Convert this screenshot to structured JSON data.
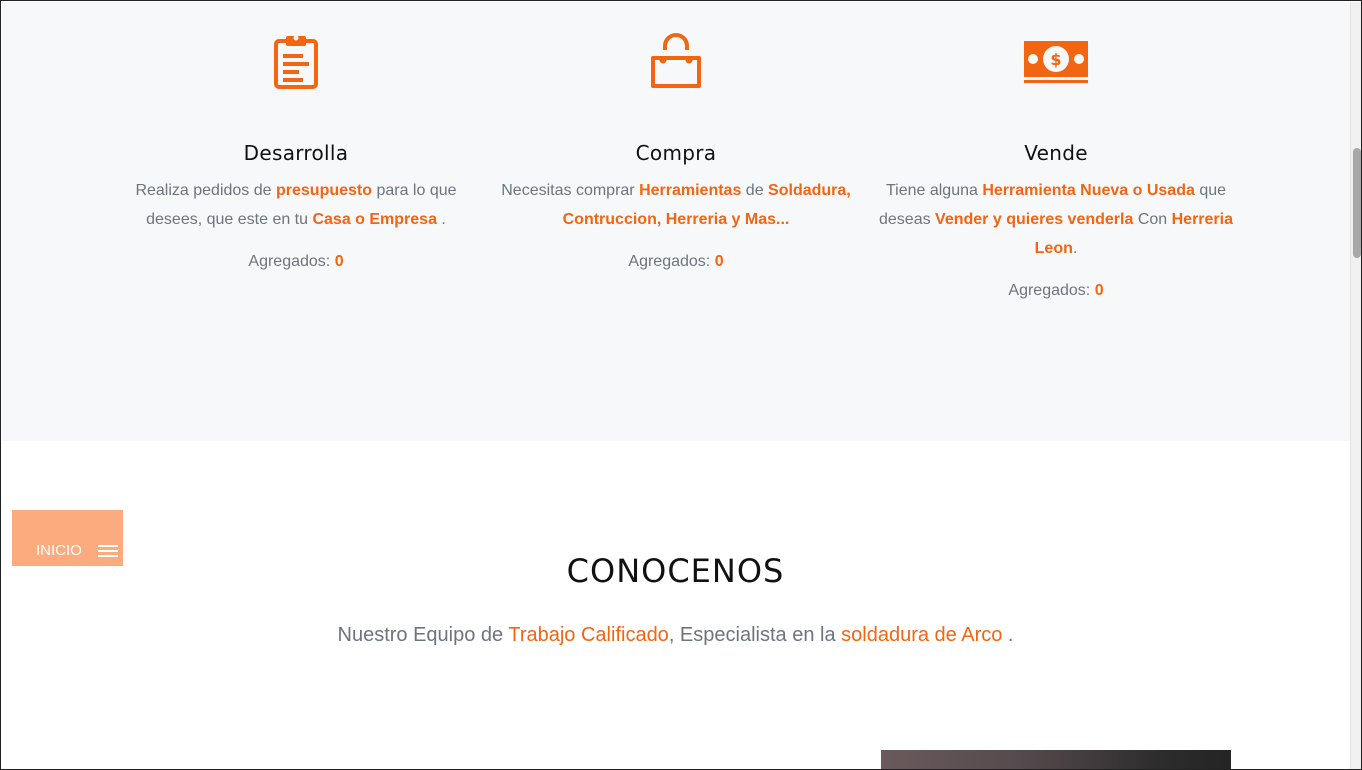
{
  "services": [
    {
      "icon": "clipboard-icon",
      "title": "Desarrolla",
      "desc": [
        {
          "t": "Realiza pedidos de ",
          "h": false
        },
        {
          "t": "presupuesto",
          "h": true
        },
        {
          "t": " para lo que desees, que este en tu ",
          "h": false
        },
        {
          "t": "Casa o Empresa",
          "h": true
        },
        {
          "t": " .",
          "h": false
        }
      ],
      "count_label": "Agregados:",
      "count_value": "0"
    },
    {
      "icon": "shopping-bag-icon",
      "title": "Compra",
      "desc": [
        {
          "t": "Necesitas comprar ",
          "h": false
        },
        {
          "t": "Herramientas",
          "h": true
        },
        {
          "t": " de ",
          "h": false
        },
        {
          "t": "Soldadura, Contruccion, Herreria y Mas...",
          "h": true
        }
      ],
      "count_label": "Agregados:",
      "count_value": "0"
    },
    {
      "icon": "money-bill-icon",
      "title": "Vende",
      "desc": [
        {
          "t": "Tiene alguna ",
          "h": false
        },
        {
          "t": "Herramienta Nueva o Usada",
          "h": true
        },
        {
          "t": " que deseas ",
          "h": false
        },
        {
          "t": "Vender y quieres venderla",
          "h": true
        },
        {
          "t": " Con ",
          "h": false
        },
        {
          "t": "Herreria Leon",
          "h": true
        },
        {
          "t": ".",
          "h": false
        }
      ],
      "count_label": "Agregados:",
      "count_value": "0"
    }
  ],
  "nav": {
    "inicio_label": "INICIO",
    "menu_icon": "hamburger-menu-icon"
  },
  "about": {
    "title": "CONOCENOS",
    "text": [
      {
        "t": "Nuestro Equipo de ",
        "h": false
      },
      {
        "t": "Trabajo Calificado",
        "h": true
      },
      {
        "t": ", Especialista en la ",
        "h": false
      },
      {
        "t": "soldadura de Arco",
        "h": true
      },
      {
        "t": " .",
        "h": false
      }
    ]
  },
  "colors": {
    "accent": "#f26511",
    "inicio_bg": "#fbab7e",
    "section_bg": "#f7f8fa"
  }
}
